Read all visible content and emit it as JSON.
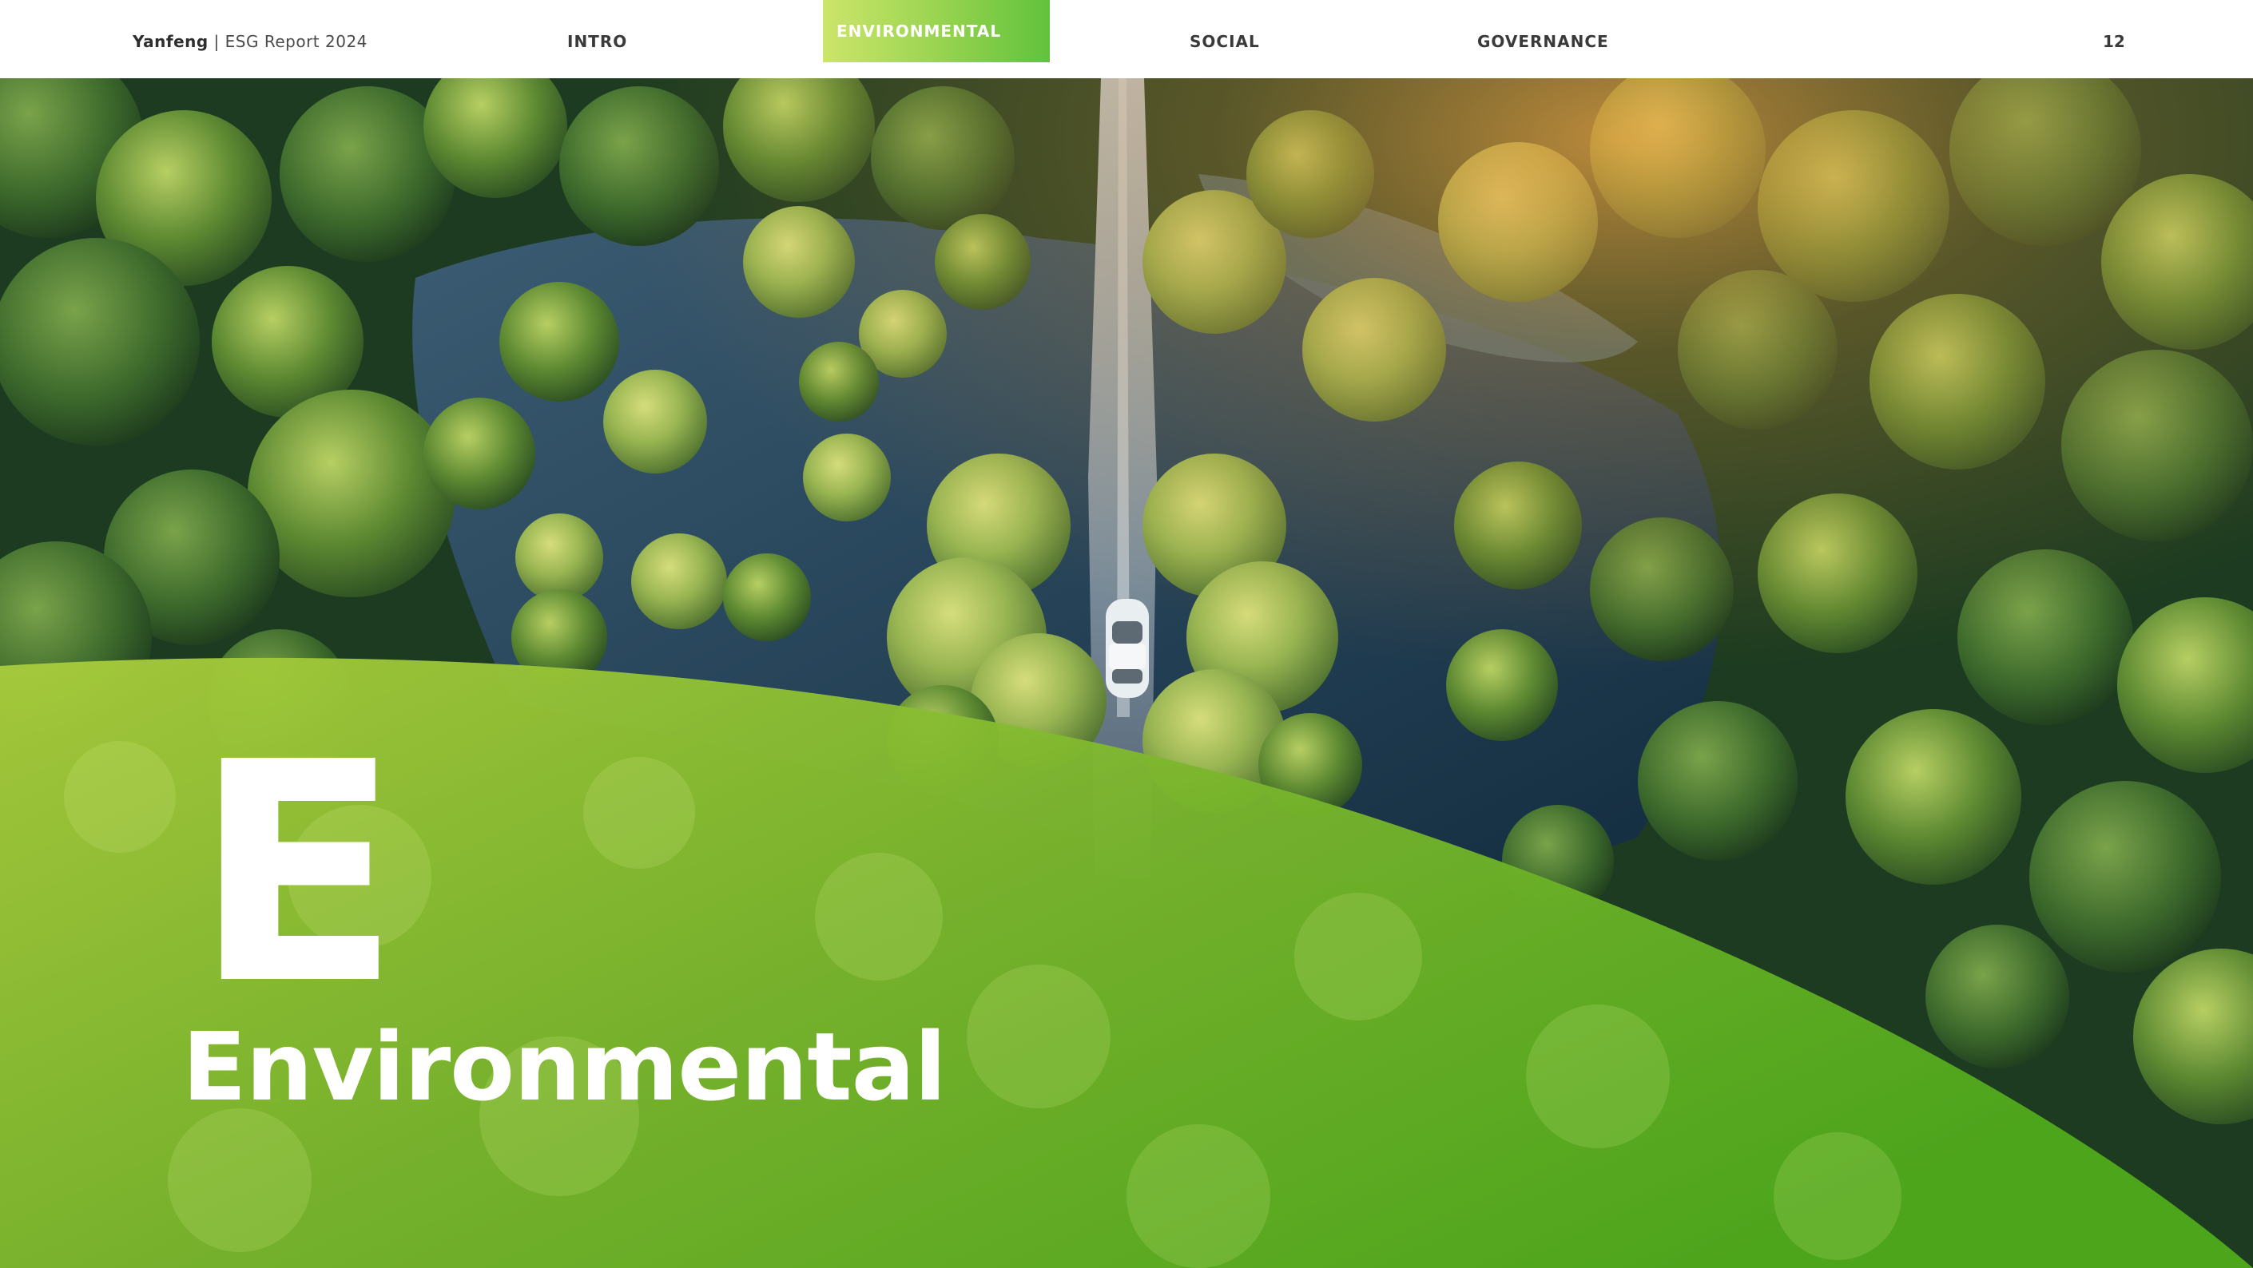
{
  "header": {
    "brand_name": "Yanfeng",
    "brand_separator": " | ",
    "brand_subtitle": "ESG Report 2024",
    "nav": {
      "intro": "INTRO",
      "environmental": "ENVIRONMENTAL",
      "social": "SOCIAL",
      "governance": "GOVERNANCE"
    },
    "active_tab": "ENVIRONMENTAL",
    "page_number": "12"
  },
  "hero": {
    "image": "aerial-forest-road-car",
    "letter": "E",
    "title": "Environmental"
  },
  "colors": {
    "accent_light": "#cde56b",
    "accent_dark": "#4fae1e",
    "forest_dark": "#14361c",
    "water": "#1f3d52"
  }
}
